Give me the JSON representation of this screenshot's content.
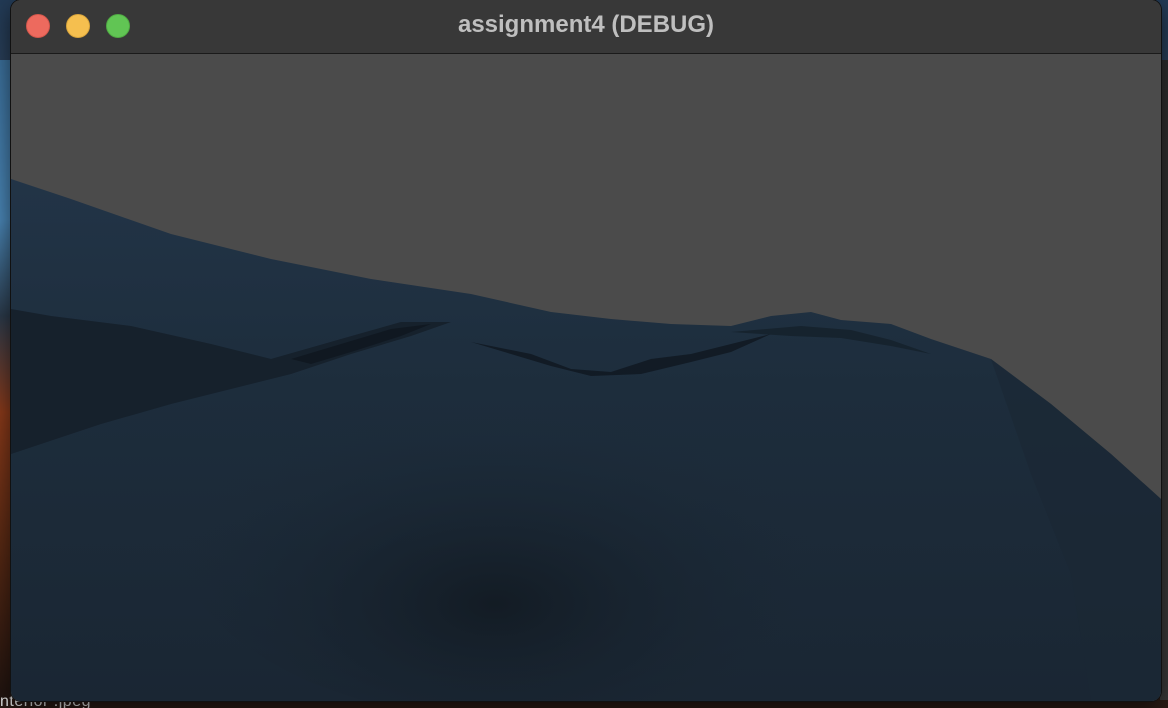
{
  "window": {
    "title": "assignment4 (DEBUG)"
  },
  "desktop": {
    "bottom_text": "nterior .jpeg"
  },
  "scene": {
    "sky_color": "#4b4b4b",
    "terrain_color": "#1c2a38",
    "terrain_shadow_color": "#121c26"
  },
  "icons": {
    "close": "close-traffic-light",
    "minimize": "minimize-traffic-light",
    "zoom": "zoom-traffic-light"
  }
}
